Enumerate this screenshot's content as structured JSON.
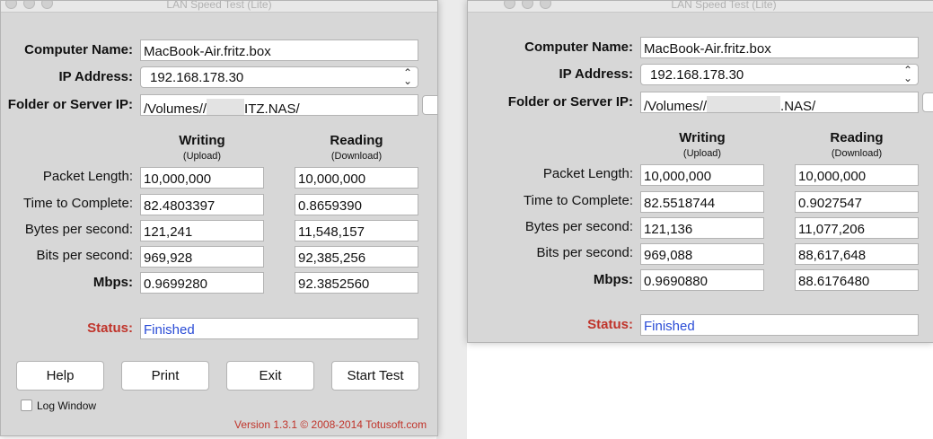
{
  "app_title": "LAN Speed Test (Lite)",
  "labels": {
    "computer_name": "Computer Name:",
    "ip_address": "IP Address:",
    "folder": "Folder or Server IP:",
    "writing": "Writing",
    "writing_sub": "(Upload)",
    "reading": "Reading",
    "reading_sub": "(Download)",
    "packet_length": "Packet Length:",
    "time_to_complete": "Time to Complete:",
    "bytes_per_second": "Bytes per second:",
    "bits_per_second": "Bits per second:",
    "mbps": "Mbps:",
    "status": "Status:"
  },
  "windows": [
    {
      "computer_name": "MacBook-Air.fritz.box",
      "ip_address": "192.168.178.30",
      "folder_prefix": "/Volumes//",
      "folder_suffix": "ITZ.NAS/",
      "writing": {
        "packet_length": "10,000,000",
        "time_to_complete": "82.4803397",
        "bytes_per_second": "121,241",
        "bits_per_second": "969,928",
        "mbps": "0.9699280"
      },
      "reading": {
        "packet_length": "10,000,000",
        "time_to_complete": "0.8659390",
        "bytes_per_second": "11,548,157",
        "bits_per_second": "92,385,256",
        "mbps": "92.3852560"
      },
      "status": "Finished"
    },
    {
      "computer_name": "MacBook-Air.fritz.box",
      "ip_address": "192.168.178.30",
      "folder_prefix": "/Volumes//",
      "folder_suffix": ".NAS/",
      "writing": {
        "packet_length": "10,000,000",
        "time_to_complete": "82.5518744",
        "bytes_per_second": "121,136",
        "bits_per_second": "969,088",
        "mbps": "0.9690880"
      },
      "reading": {
        "packet_length": "10,000,000",
        "time_to_complete": "0.9027547",
        "bytes_per_second": "11,077,206",
        "bits_per_second": "88,617,648",
        "mbps": "88.6176480"
      },
      "status": "Finished"
    }
  ],
  "buttons": {
    "help": "Help",
    "print": "Print",
    "exit": "Exit",
    "start_test": "Start Test"
  },
  "log_window_label": "Log Window",
  "version": "Version 1.3.1 © 2008-2014 Totusoft.com",
  "colors": {
    "status_label": "#c0342b",
    "status_value": "#2a4cd6",
    "window_bg": "#d7d7d7"
  }
}
